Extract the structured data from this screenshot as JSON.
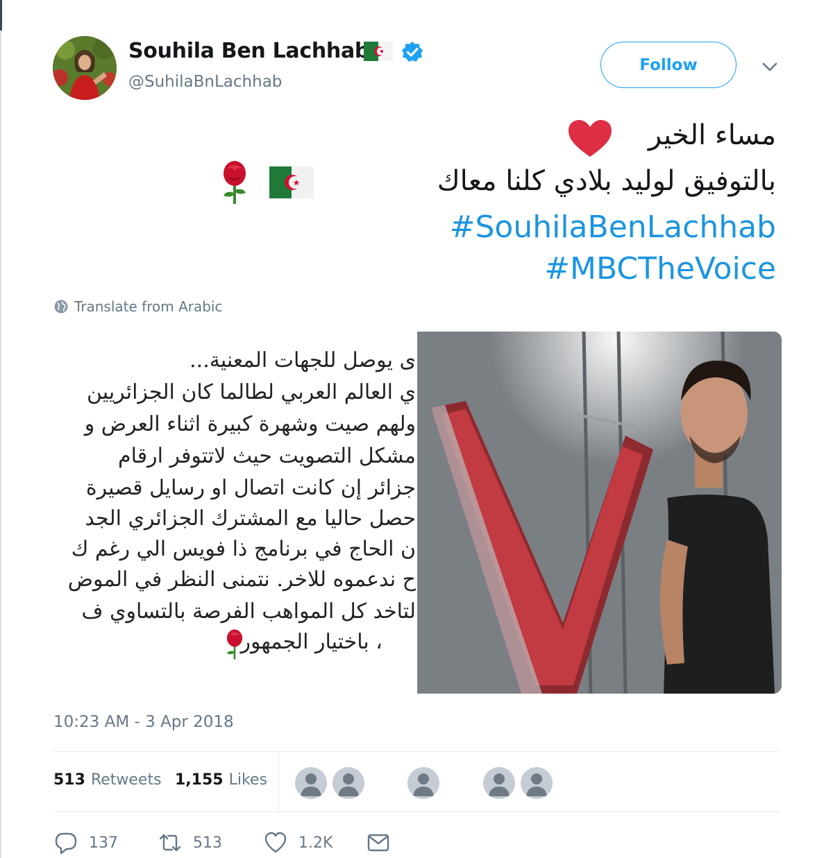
{
  "colors": {
    "accent": "#1da1f2",
    "hashtag": "#1b95e0",
    "secondary_text": "#657786",
    "heart": "#e0245e",
    "verified": "#1da1f2"
  },
  "author": {
    "display_name": "Souhila Ben Lachhab",
    "handle": "@SuhilaBnLachhab",
    "verified": true,
    "name_flag_icon": "algeria-flag-icon"
  },
  "header": {
    "follow_label": "Follow",
    "more_icon": "chevron-down-icon"
  },
  "tweet": {
    "line1": "مساء الخير",
    "line1_emoji": "red-heart-icon",
    "line2": "بالتوفيق لوليد بلادي كلنا معاك",
    "line2_emojis": [
      "algeria-flag-icon",
      "rose-icon"
    ],
    "hashtags": [
      "#SouhilaBenLachhab",
      "#MBCTheVoice"
    ]
  },
  "translate": {
    "label": "Translate from Arabic",
    "icon": "globe-icon"
  },
  "media": {
    "text_lines": [
      "ى يوصل للجهات المعنية...",
      "ي العالم العربي لطالما كان الجزائريين",
      "ولهم صيت وشهرة كبيرة اثناء العرض و",
      "مشكل التصويت حيث لاتتوفر ارقام",
      "جزائر إن كانت اتصال او رسايل قصيرة",
      "حصل حاليا مع المشترك الجزائري الجد",
      "ن الحاج في برنامج ذا فويس الي رغم ك",
      "ح ندعموه للاخر. نتمنى النظر في الموض",
      "لتاخد كل المواهب الفرصة بالتساوي ف",
      "، باختيار الجمهور"
    ],
    "text_end_emoji": "rose-icon",
    "photo_subject": "person-photo"
  },
  "timestamp": "10:23 AM - 3 Apr 2018",
  "stats": {
    "retweets_count": "513",
    "retweets_label": "Retweets",
    "likes_count": "1,155",
    "likes_label": "Likes",
    "liker_avatars": 5
  },
  "actions": {
    "replies": "137",
    "retweets": "513",
    "likes": "1.2K",
    "icons": [
      "reply-icon",
      "retweet-icon",
      "heart-icon",
      "envelope-icon"
    ]
  }
}
